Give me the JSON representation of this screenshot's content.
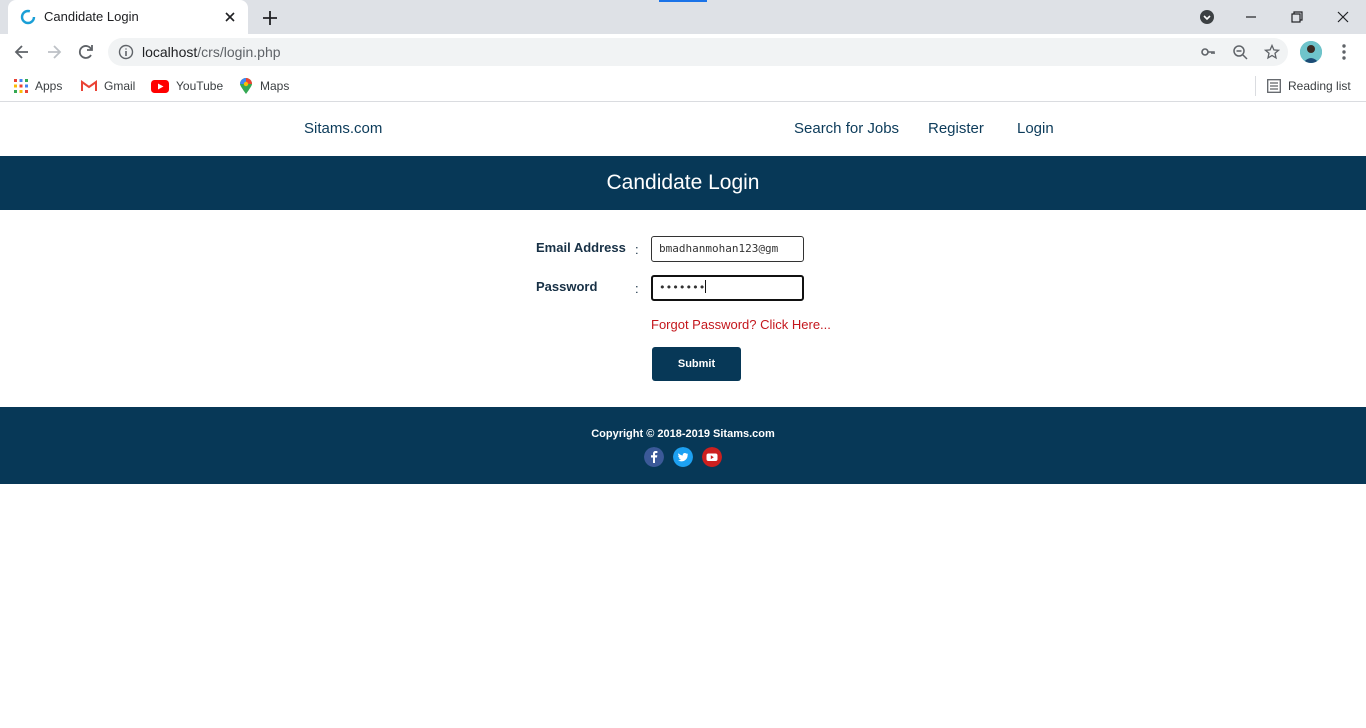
{
  "browser": {
    "tab_title": "Candidate Login",
    "url_host": "localhost",
    "url_path": "/crs/login.php",
    "bookmarks": [
      "Apps",
      "Gmail",
      "YouTube",
      "Maps"
    ],
    "reading_list": "Reading list"
  },
  "site": {
    "brand": "Sitams.com",
    "nav": [
      "Search for Jobs",
      "Register",
      "Login"
    ],
    "page_title": "Candidate Login"
  },
  "form": {
    "email_label": "Email Address",
    "email_value": "bmadhanmohan123@gm",
    "password_label": "Password",
    "password_value": "•••••••",
    "colon": ":",
    "forgot_link": "Forgot Password? Click Here...",
    "submit_label": "Submit"
  },
  "footer": {
    "copyright": "Copyright © 2018-2019 Sitams.com",
    "social_icons": [
      "facebook-icon",
      "twitter-icon",
      "youtube-icon"
    ]
  },
  "colors": {
    "primary": "#073857",
    "link_red": "#c4161c"
  }
}
